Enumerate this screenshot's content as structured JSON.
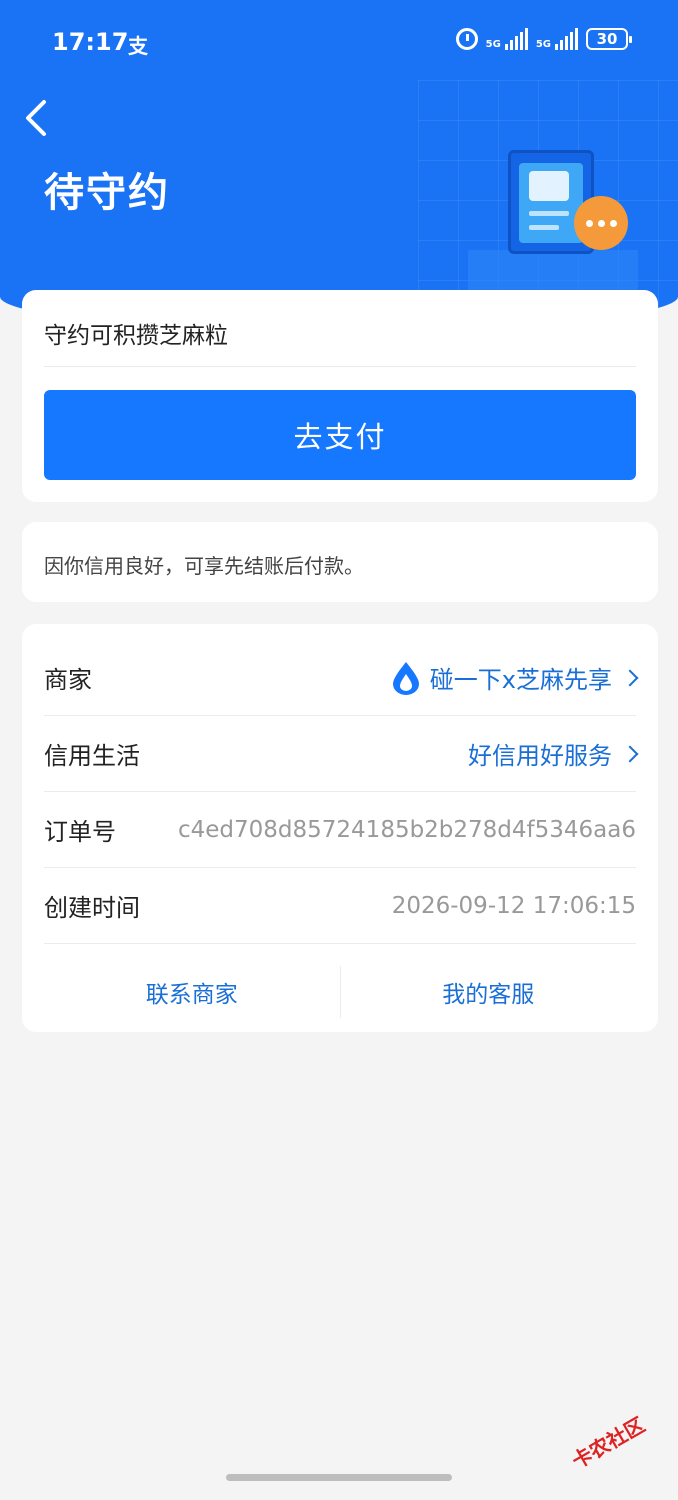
{
  "status_bar": {
    "time": "17:17",
    "app_glyph": "支",
    "net1": "5G",
    "net2": "5G",
    "battery": "30"
  },
  "header": {
    "title": "待守约",
    "back_icon": "chevron-left-icon"
  },
  "pay_card": {
    "hint": "守约可积攒芝麻粒",
    "button_label": "去支付"
  },
  "notice": {
    "text": "因你信用良好，可享先结账后付款。"
  },
  "info": {
    "rows": [
      {
        "label": "商家",
        "value": "碰一下x芝麻先享"
      },
      {
        "label": "信用生活",
        "value": "好信用好服务"
      },
      {
        "label": "订单号",
        "value": "c4ed708d85724185b2b278d4f5346aa6"
      },
      {
        "label": "创建时间",
        "value": "2026-09-12 17:06:15"
      }
    ],
    "contact_merchant": "联系商家",
    "my_service": "我的客服"
  },
  "watermark": "卡农社区",
  "colors": {
    "primary": "#1677ff",
    "header_bg": "#1a73f5",
    "link": "#1a6fd6",
    "badge": "#f59a3a"
  }
}
